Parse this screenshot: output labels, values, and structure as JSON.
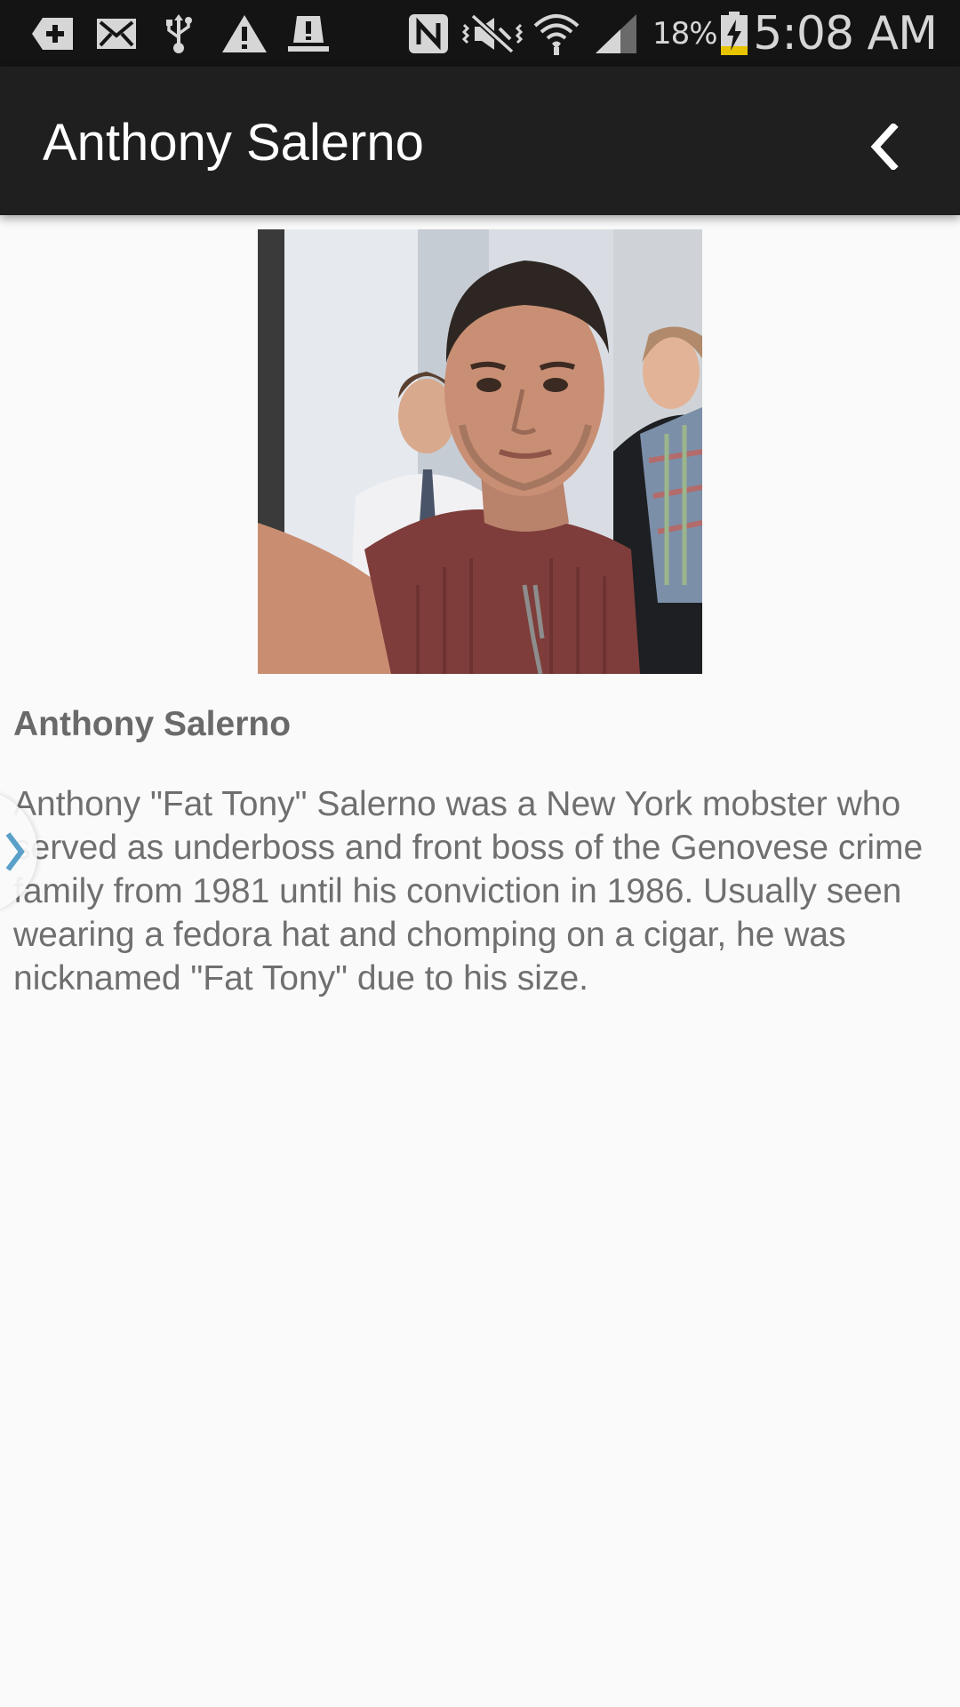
{
  "status_bar": {
    "icons": [
      "add-icon",
      "mail-icon",
      "usb-icon",
      "warning-icon",
      "stamp-icon",
      "nfc-icon",
      "vibrate-mute-icon",
      "wifi-icon",
      "signal-icon",
      "battery-charging-icon"
    ],
    "battery_percent": "18%",
    "time": "5:08 AM"
  },
  "app_bar": {
    "title": "Anthony Salerno",
    "back_icon": "chevron-left-icon"
  },
  "profile": {
    "name": "Anthony Salerno",
    "bio": "Anthony \"Fat Tony\" Salerno was a New York mobster who served as underboss and front boss of the Genovese crime family from 1981 until his conviction in 1986. Usually seen wearing a fedora hat and chomping on a cigar, he was nicknamed \"Fat Tony\" due to his size."
  },
  "drawer": {
    "icon": "chevron-right-icon"
  },
  "colors": {
    "status_bar_bg": "#141414",
    "app_bar_bg": "#1f1f1f",
    "page_bg": "#fafafa",
    "text_gray": "#6f6f6f",
    "drawer_chevron": "#5aa0c8",
    "battery_charge": "#e8c400"
  }
}
